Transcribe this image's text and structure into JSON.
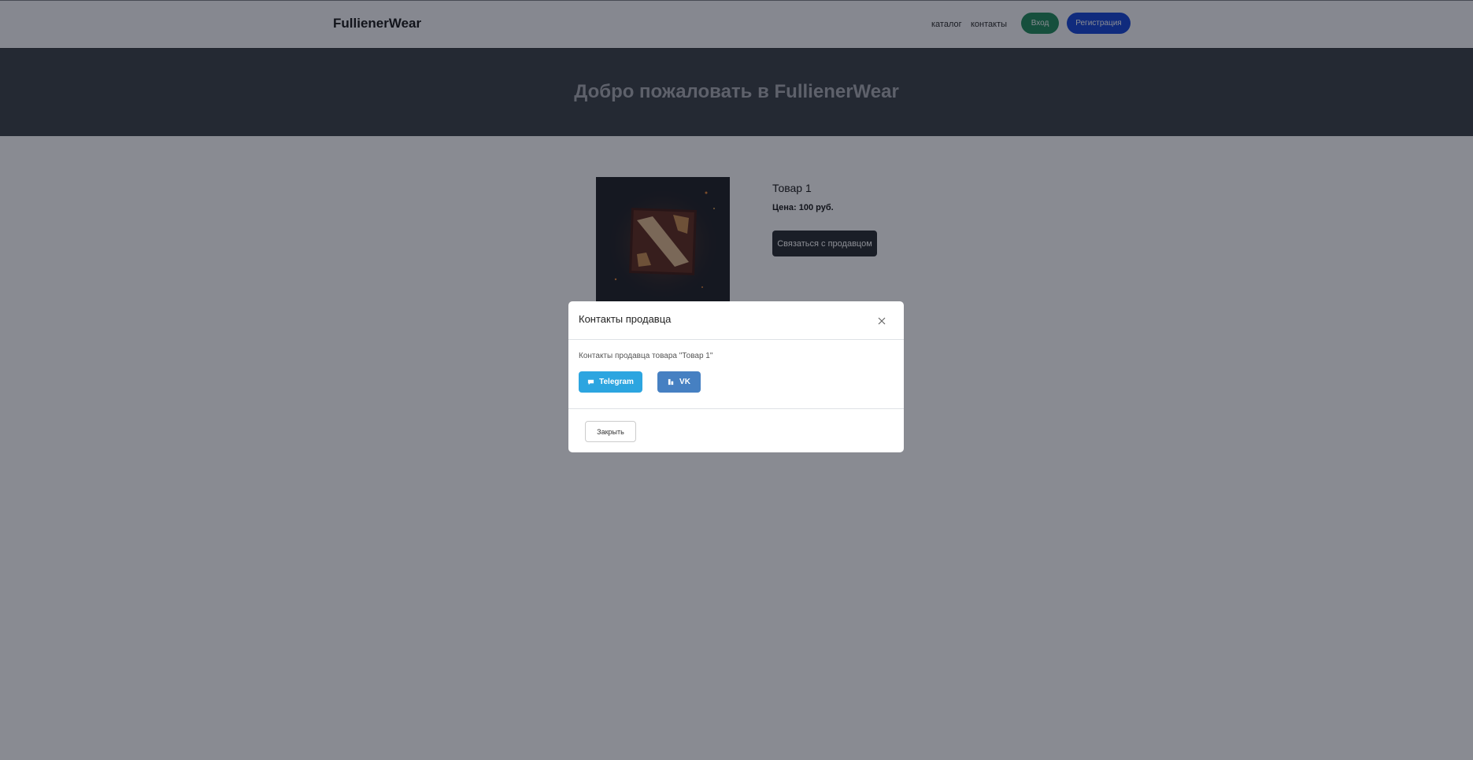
{
  "navbar": {
    "brand": "FullienerWear",
    "links": [
      "каталог",
      "контакты"
    ],
    "login_label": "Вход",
    "register_label": "Регистрация"
  },
  "hero": {
    "title": "Добро пожаловать в FullienerWear"
  },
  "product": {
    "title": "Товар 1",
    "price": "Цена: 100 руб.",
    "contact_button": "Связаться с продавцом",
    "image_icon": "dota-logo-image"
  },
  "modal": {
    "title": "Контакты продавца",
    "description": "Контакты продавца товара \"Товар 1\"",
    "telegram_label": "Telegram",
    "vk_label": "VK",
    "close_label": "Закрыть"
  },
  "colors": {
    "login": "#198754",
    "register": "#0d3fd4",
    "hero_bg": "#343a40",
    "telegram": "#2ca5e0",
    "vk": "#4680c2",
    "dark_button": "#212529"
  }
}
